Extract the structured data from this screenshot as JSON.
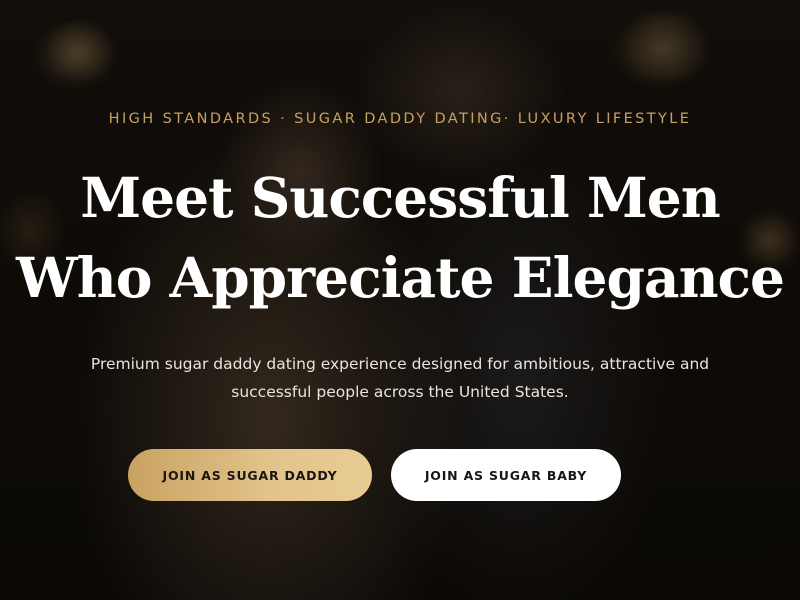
{
  "hero": {
    "eyebrow": "HIGH STANDARDS · SUGAR DADDY DATING· LUXURY LIFESTYLE",
    "headline_line1": "Meet Successful Men",
    "headline_line2": "Who Appreciate Elegance",
    "subtitle_line1": "Premium sugar daddy dating experience designed for ambitious, attractive and",
    "subtitle_line2": "successful people across the United States.",
    "buttons": {
      "daddy": "JOIN AS SUGAR DADDY",
      "baby": "JOIN AS SUGAR BABY"
    }
  },
  "colors": {
    "accent_gold": "#c8a062",
    "button_gold": "#e3c48c",
    "button_white": "#ffffff",
    "text": "#ffffff"
  }
}
